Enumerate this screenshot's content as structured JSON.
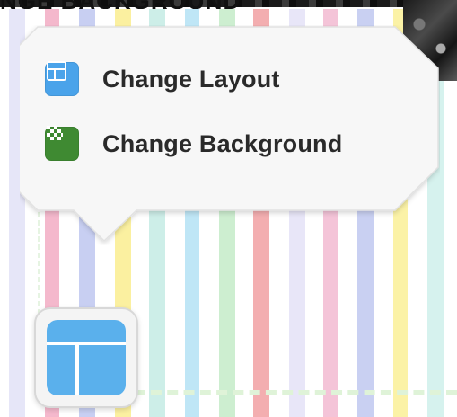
{
  "page": {
    "heading_fragment": "NGE BACKGROUND"
  },
  "popover": {
    "items": [
      {
        "label": "Change Layout",
        "icon": "layout-icon",
        "icon_color": "#4aa3ea"
      },
      {
        "label": "Change Background",
        "icon": "checkerboard-background-icon",
        "icon_color": "#3f8a32"
      }
    ]
  },
  "toolbar": {
    "layout_button_icon": "layout-icon",
    "accent": "#5ab0ec"
  },
  "background": {
    "stripe_colors": [
      "#e6e6f8",
      "#f4b8cc",
      "#c8cff2",
      "#fbf0a0",
      "#cdeee8",
      "#bfe6f6",
      "#cdeed0",
      "#f3aeb0",
      "#e8e6f8",
      "#f4c4d8",
      "#c9d0f2",
      "#fbf2a6",
      "#d6f2ee"
    ]
  }
}
